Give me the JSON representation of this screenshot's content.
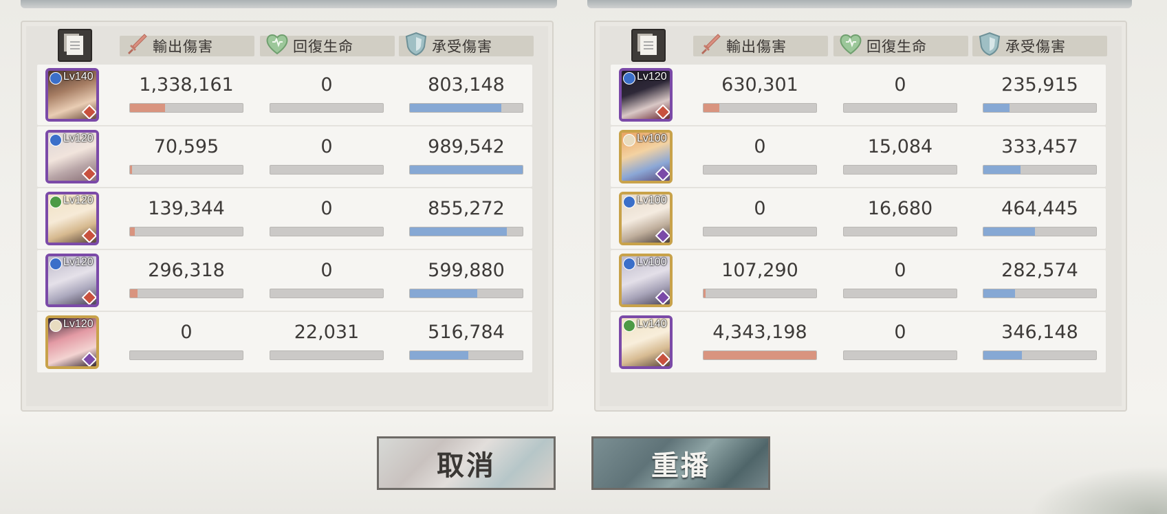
{
  "columns": {
    "damage_dealt": "輸出傷害",
    "healing": "回復生命",
    "damage_taken": "承受傷害"
  },
  "colors": {
    "damage_bar": "#d9947f",
    "taken_bar": "#86a8d4",
    "bar_track": "#cbc9c7"
  },
  "teams": [
    {
      "rows": [
        {
          "level": "Lv140",
          "rarity": "purple",
          "element": "water",
          "dealt": "1,338,161",
          "healed": "0",
          "taken": "803,148",
          "dealt_ratio": 0.31,
          "healed_ratio": 0,
          "taken_ratio": 0.81
        },
        {
          "level": "Lv120",
          "rarity": "purple",
          "element": "water",
          "dealt": "70,595",
          "healed": "0",
          "taken": "989,542",
          "dealt_ratio": 0.02,
          "healed_ratio": 0,
          "taken_ratio": 1.0
        },
        {
          "level": "Lv120",
          "rarity": "purple",
          "element": "wind",
          "dealt": "139,344",
          "healed": "0",
          "taken": "855,272",
          "dealt_ratio": 0.04,
          "healed_ratio": 0,
          "taken_ratio": 0.86
        },
        {
          "level": "Lv120",
          "rarity": "purple",
          "element": "water",
          "dealt": "296,318",
          "healed": "0",
          "taken": "599,880",
          "dealt_ratio": 0.07,
          "healed_ratio": 0,
          "taken_ratio": 0.6
        },
        {
          "level": "Lv120",
          "rarity": "gold",
          "element": "light",
          "dealt": "0",
          "healed": "22,031",
          "taken": "516,784",
          "dealt_ratio": 0,
          "healed_ratio": 0,
          "taken_ratio": 0.52
        }
      ]
    },
    {
      "rows": [
        {
          "level": "Lv120",
          "rarity": "purple",
          "element": "water",
          "dealt": "630,301",
          "healed": "0",
          "taken": "235,915",
          "dealt_ratio": 0.14,
          "healed_ratio": 0,
          "taken_ratio": 0.23
        },
        {
          "level": "Lv100",
          "rarity": "gold",
          "element": "light",
          "dealt": "0",
          "healed": "15,084",
          "taken": "333,457",
          "dealt_ratio": 0,
          "healed_ratio": 0,
          "taken_ratio": 0.33
        },
        {
          "level": "Lv100",
          "rarity": "gold",
          "element": "water",
          "dealt": "0",
          "healed": "16,680",
          "taken": "464,445",
          "dealt_ratio": 0,
          "healed_ratio": 0,
          "taken_ratio": 0.46
        },
        {
          "level": "Lv100",
          "rarity": "gold",
          "element": "water",
          "dealt": "107,290",
          "healed": "0",
          "taken": "282,574",
          "dealt_ratio": 0.02,
          "healed_ratio": 0,
          "taken_ratio": 0.28
        },
        {
          "level": "Lv140",
          "rarity": "purple",
          "element": "wind",
          "dealt": "4,343,198",
          "healed": "0",
          "taken": "346,148",
          "dealt_ratio": 1.0,
          "healed_ratio": 0,
          "taken_ratio": 0.34
        }
      ]
    }
  ],
  "buttons": {
    "cancel": "取消",
    "replay": "重播"
  }
}
